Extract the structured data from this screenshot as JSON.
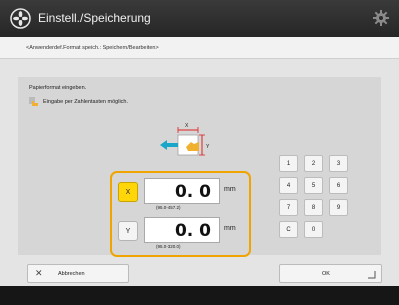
{
  "header": {
    "title": "Einstell./Speicherung",
    "app_icon": "settings-register-icon",
    "right_icon": "gear-icon"
  },
  "breadcrumb": "<Anwenderdef.Format speich.: Speichern/Bearbeiten>",
  "panel": {
    "instruction": "Papierformat eingeben.",
    "hint": "Eingabe per Zahlentasten möglich.",
    "hint_icon": "hand-pointer-icon",
    "diagram_labels": {
      "x": "X",
      "y": "Y"
    }
  },
  "fields": {
    "x": {
      "axis": "X",
      "value": "0. 0",
      "unit": "mm",
      "range": "(95.0-457.2)",
      "active": true
    },
    "y": {
      "axis": "Y",
      "value": "0. 0",
      "unit": "mm",
      "range": "(95.0-320.0)",
      "active": false
    }
  },
  "keypad": {
    "keys": [
      "1",
      "2",
      "3",
      "4",
      "5",
      "6",
      "7",
      "8",
      "9",
      "C",
      "0"
    ]
  },
  "footer": {
    "cancel_label": "Abbrechen",
    "ok_label": "OK"
  },
  "colors": {
    "highlight": "#f0a400",
    "active_axis": "#ffd60a",
    "arrow": "#19a7c9"
  }
}
